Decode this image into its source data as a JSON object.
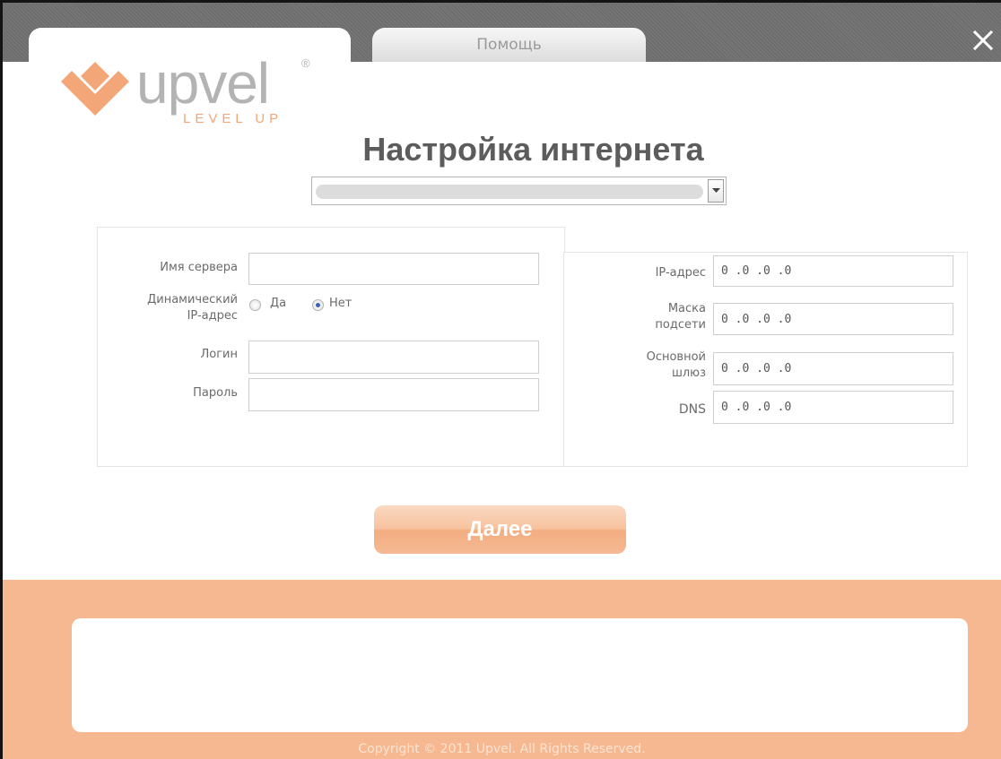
{
  "tabs": {
    "help_label": "Помощь"
  },
  "logo": {
    "word": "upvel",
    "registered": "®",
    "tagline": "LEVEL UP",
    "accent_color": "#f3a677"
  },
  "page_title": "Настройка интернета",
  "connection_select": {
    "selected": ""
  },
  "left_form": {
    "server_name_label": "Имя сервера",
    "server_name_value": "",
    "dynamic_ip_label_line1": "Динамический",
    "dynamic_ip_label_line2": "IP-адрес",
    "dynamic_ip_yes": "Да",
    "dynamic_ip_no": "Нет",
    "dynamic_ip_selected": "Нет",
    "login_label": "Логин",
    "login_value": "",
    "password_label": "Пароль",
    "password_value": ""
  },
  "right_form": {
    "ip_label": "IP-адрес",
    "ip_value": "0 .0 .0 .0",
    "mask_label_line1": "Маска",
    "mask_label_line2": "подсети",
    "mask_value": "0 .0 .0 .0",
    "gateway_label_line1": "Основной",
    "gateway_label_line2": "шлюз",
    "gateway_value": "0 .0 .0 .0",
    "dns_label": "DNS",
    "dns_value": "0 .0 .0 .0"
  },
  "next_button_label": "Далее",
  "message_box_text": "",
  "footer": {
    "copyright": "Copyright © 2011 Upvel. All Rights Reserved."
  },
  "colors": {
    "accent": "#f6b891",
    "title": "#5c5c5c"
  },
  "icons": {
    "close": "close-icon",
    "dropdown": "chevron-down-icon",
    "logo_mark": "upvel-chevron-logo"
  }
}
